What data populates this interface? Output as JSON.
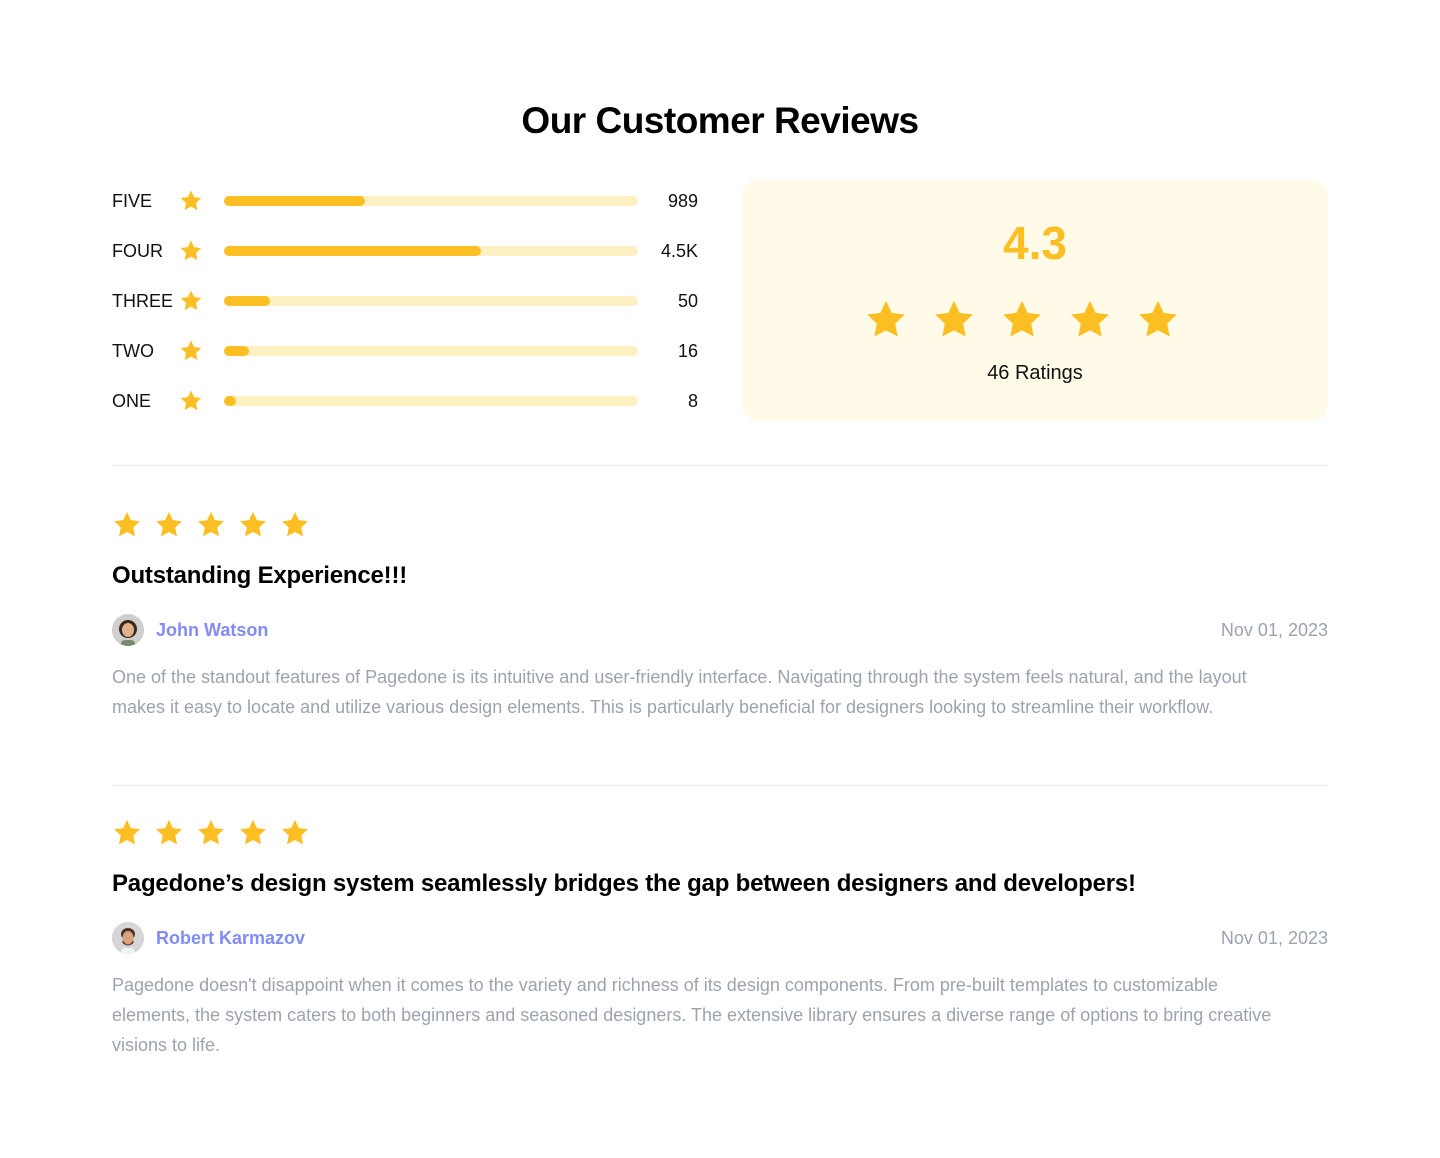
{
  "page_title": "Our Customer Reviews",
  "accent_color": "#fbbf24",
  "track_color": "#fdf0c2",
  "distribution": [
    {
      "label": "FIVE",
      "count": "989",
      "fill_fraction": 0.34
    },
    {
      "label": "FOUR",
      "count": "4.5K",
      "fill_fraction": 0.62
    },
    {
      "label": "THREE",
      "count": "50",
      "fill_fraction": 0.11
    },
    {
      "label": "TWO",
      "count": "16",
      "fill_fraction": 0.06
    },
    {
      "label": "ONE",
      "count": "8",
      "fill_fraction": 0.03
    }
  ],
  "summary": {
    "score": "4.3",
    "stars": 5,
    "ratings_label": "46 Ratings"
  },
  "reviews": [
    {
      "stars": 5,
      "title": "Outstanding Experience!!!",
      "author": "John Watson",
      "date": "Nov 01, 2023",
      "avatar_icon": "avatar-john-watson",
      "text": "One of the standout features of Pagedone is its intuitive and user-friendly interface. Navigating through the system feels natural, and the layout makes it easy to locate and utilize various design elements. This is particularly beneficial for designers looking to streamline their workflow."
    },
    {
      "stars": 5,
      "title": "Pagedone’s design system seamlessly bridges the gap between designers and developers!",
      "author": "Robert Karmazov",
      "date": "Nov 01, 2023",
      "avatar_icon": "avatar-robert-karmazov",
      "text": "Pagedone doesn't disappoint when it comes to the variety and richness of its design components. From pre-built templates to customizable elements, the system caters to both beginners and seasoned designers. The extensive library ensures a diverse range of options to bring creative visions to life."
    }
  ]
}
